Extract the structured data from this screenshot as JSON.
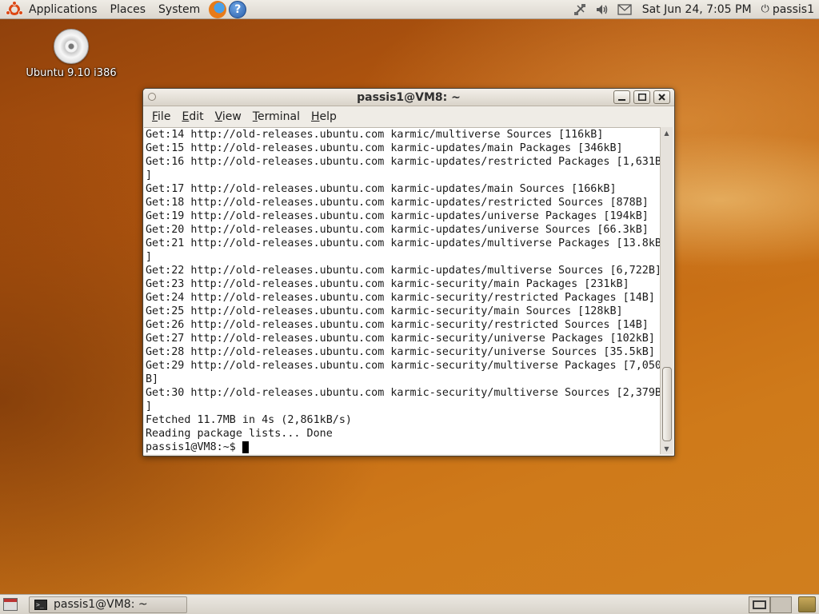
{
  "top_panel": {
    "menus": [
      "Applications",
      "Places",
      "System"
    ],
    "clock": "Sat Jun 24,  7:05 PM",
    "user": "passis1"
  },
  "desktop": {
    "icons": [
      {
        "label": "Ubuntu 9.10 i386",
        "icon": "cd-icon"
      }
    ]
  },
  "terminal": {
    "title": "passis1@VM8: ~",
    "menubar": [
      {
        "label": "File"
      },
      {
        "label": "Edit"
      },
      {
        "label": "View"
      },
      {
        "label": "Terminal"
      },
      {
        "label": "Help"
      }
    ],
    "lines": [
      "Get:14 http://old-releases.ubuntu.com karmic/multiverse Sources [116kB]",
      "Get:15 http://old-releases.ubuntu.com karmic-updates/main Packages [346kB]",
      "Get:16 http://old-releases.ubuntu.com karmic-updates/restricted Packages [1,631B",
      "]",
      "Get:17 http://old-releases.ubuntu.com karmic-updates/main Sources [166kB]",
      "Get:18 http://old-releases.ubuntu.com karmic-updates/restricted Sources [878B]",
      "Get:19 http://old-releases.ubuntu.com karmic-updates/universe Packages [194kB]",
      "Get:20 http://old-releases.ubuntu.com karmic-updates/universe Sources [66.3kB]",
      "Get:21 http://old-releases.ubuntu.com karmic-updates/multiverse Packages [13.8kB",
      "]",
      "Get:22 http://old-releases.ubuntu.com karmic-updates/multiverse Sources [6,722B]",
      "Get:23 http://old-releases.ubuntu.com karmic-security/main Packages [231kB]",
      "Get:24 http://old-releases.ubuntu.com karmic-security/restricted Packages [14B]",
      "Get:25 http://old-releases.ubuntu.com karmic-security/main Sources [128kB]",
      "Get:26 http://old-releases.ubuntu.com karmic-security/restricted Sources [14B]",
      "Get:27 http://old-releases.ubuntu.com karmic-security/universe Packages [102kB]",
      "Get:28 http://old-releases.ubuntu.com karmic-security/universe Sources [35.5kB]",
      "Get:29 http://old-releases.ubuntu.com karmic-security/multiverse Packages [7,050",
      "B]",
      "Get:30 http://old-releases.ubuntu.com karmic-security/multiverse Sources [2,379B",
      "]",
      "Fetched 11.7MB in 4s (2,861kB/s)",
      "Reading package lists... Done"
    ],
    "prompt": "passis1@VM8:~$"
  },
  "bottom_panel": {
    "tasks": [
      {
        "label": "passis1@VM8: ~"
      }
    ]
  }
}
